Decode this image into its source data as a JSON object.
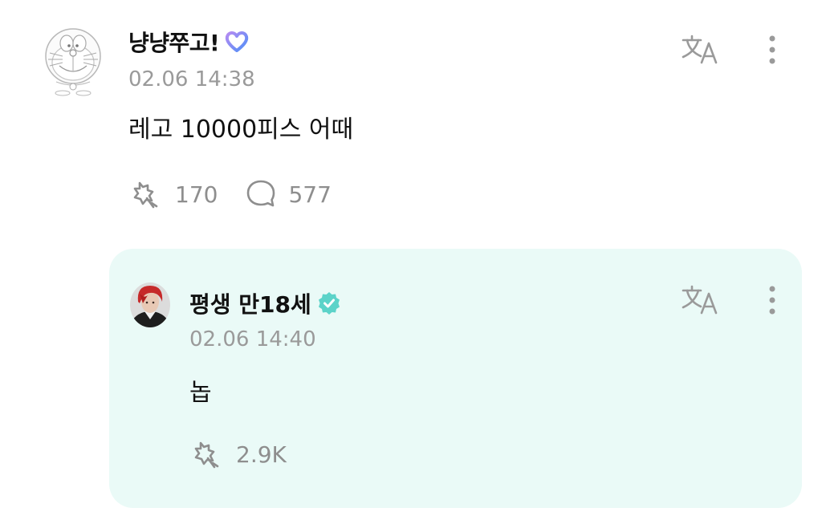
{
  "post": {
    "username": "냥냥쭈고!",
    "badge_icon": "heart-badge-icon",
    "timestamp": "02.06 14:38",
    "body": "레고 10000피스 어때",
    "likes": "170",
    "comments": "577",
    "avatar_icon": "doraemon-sketch-avatar"
  },
  "reply": {
    "username": "평생 만18세",
    "badge_icon": "verified-badge-icon",
    "timestamp": "02.06 14:40",
    "body": "놉",
    "likes": "2.9K",
    "avatar_icon": "red-hair-person-avatar"
  },
  "colors": {
    "reply_background": "#eafaf7",
    "verified_badge": "#5cd3c9",
    "muted_text": "#9a9a9a",
    "heart_badge_start": "#a98bf5",
    "heart_badge_end": "#5a8cf7"
  }
}
